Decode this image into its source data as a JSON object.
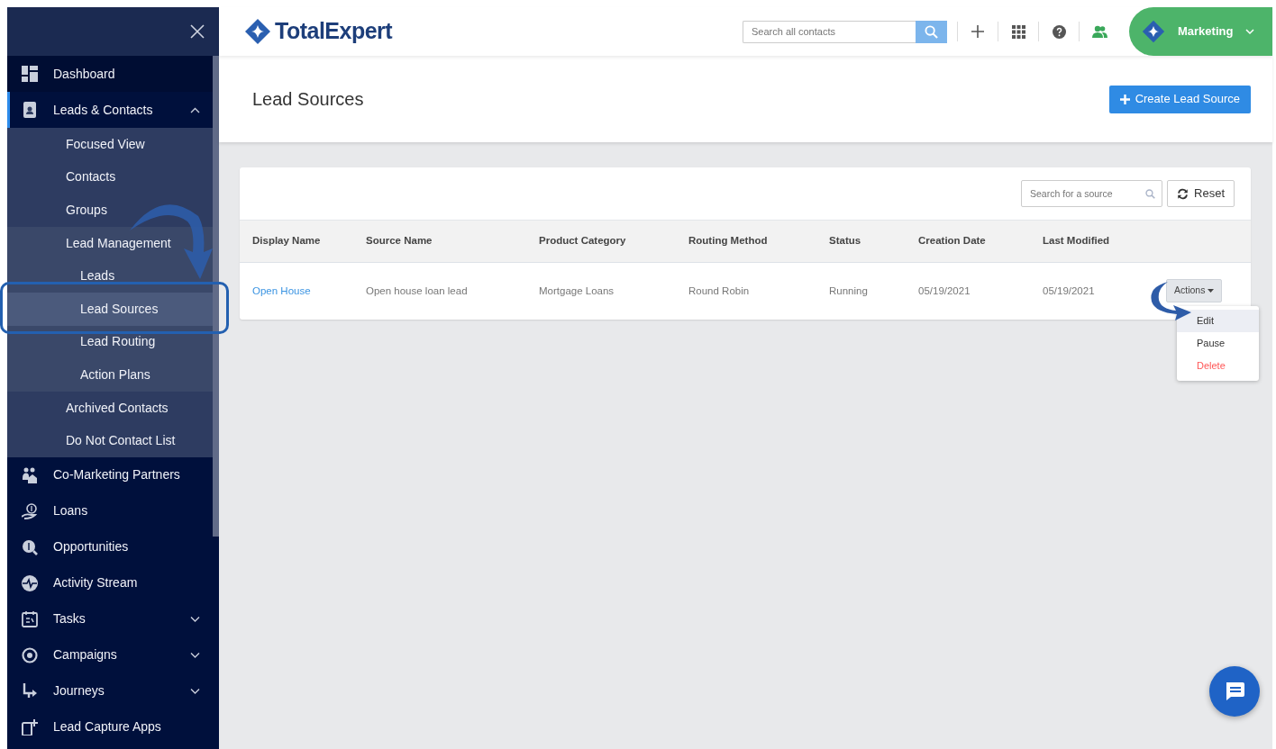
{
  "sidebar": {
    "items": [
      {
        "label": "Dashboard",
        "selected": false
      },
      {
        "label": "Leads & Contacts",
        "selected": false,
        "expanded": true,
        "children": [
          {
            "label": "Focused View",
            "selected": false
          },
          {
            "label": "Contacts",
            "selected": false
          },
          {
            "label": "Groups",
            "selected": false
          },
          {
            "label": "Lead Management",
            "selected": false,
            "children": [
              {
                "label": "Leads",
                "selected": false
              },
              {
                "label": "Lead Sources",
                "selected": true
              },
              {
                "label": "Lead Routing",
                "selected": false
              },
              {
                "label": "Action Plans",
                "selected": false
              }
            ]
          },
          {
            "label": "Archived Contacts",
            "selected": false
          },
          {
            "label": "Do Not Contact List",
            "selected": false
          }
        ]
      },
      {
        "label": "Co-Marketing Partners",
        "selected": false
      },
      {
        "label": "Loans",
        "selected": false
      },
      {
        "label": "Opportunities",
        "selected": false
      },
      {
        "label": "Activity Stream",
        "selected": false
      },
      {
        "label": "Tasks",
        "selected": false,
        "expanded": false
      },
      {
        "label": "Campaigns",
        "selected": false,
        "expanded": false
      },
      {
        "label": "Journeys",
        "selected": false,
        "expanded": false
      },
      {
        "label": "Lead Capture Apps",
        "selected": false
      }
    ]
  },
  "topbar": {
    "logo": "TotalExpert",
    "search": {
      "placeholder": "Search all contacts"
    },
    "account": "Marketing"
  },
  "page": {
    "title": "Lead Sources",
    "create_button": "Create Lead Source"
  },
  "table": {
    "search": {
      "placeholder": "Search for a source"
    },
    "reset_button": "Reset",
    "columns": [
      "Display Name",
      "Source Name",
      "Product Category",
      "Routing Method",
      "Status",
      "Creation Date",
      "Last Modified"
    ],
    "rows": [
      {
        "cells": [
          "Open House",
          "Open house loan lead",
          "Mortgage Loans",
          "Round Robin",
          "Running",
          "05/19/2021",
          "05/19/2021"
        ],
        "actions": "Actions",
        "menu": [
          {
            "label": "Edit",
            "selected": true,
            "kind": "normal"
          },
          {
            "label": "Pause",
            "selected": false,
            "kind": "normal"
          },
          {
            "label": "Delete",
            "selected": false,
            "kind": "danger"
          }
        ]
      }
    ]
  }
}
